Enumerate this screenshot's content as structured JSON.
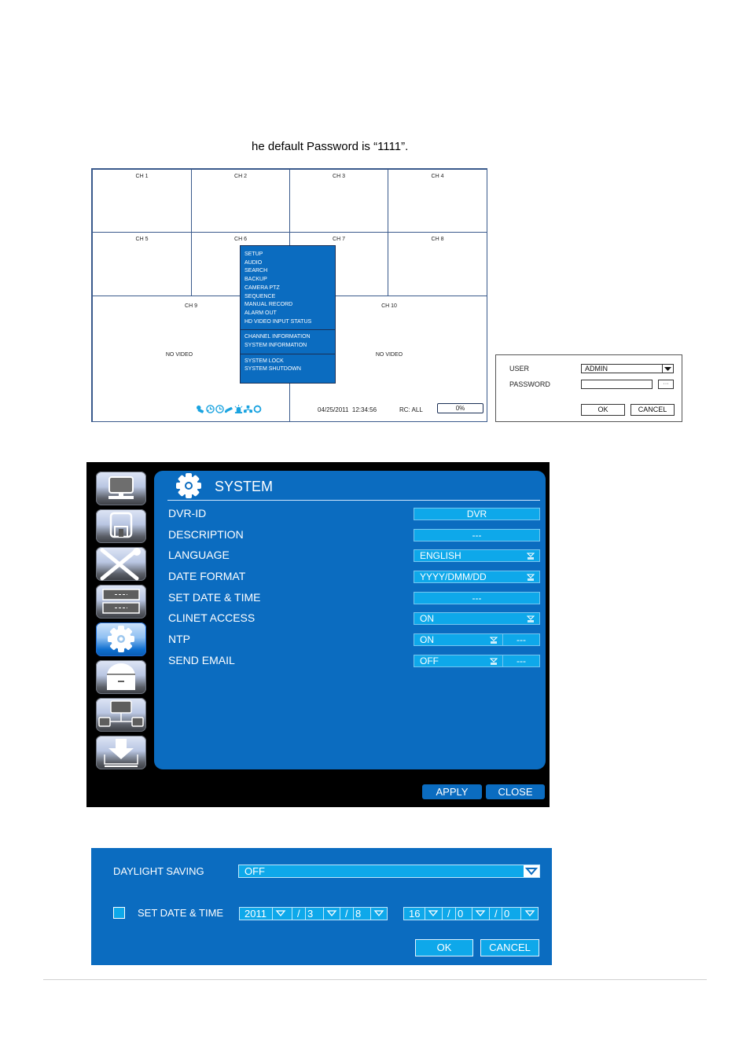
{
  "intro_text": "he default Password is “1111”.",
  "live_view": {
    "channels": [
      "CH 1",
      "CH 2",
      "CH 3",
      "CH 4",
      "CH 5",
      "CH 6",
      "CH 7",
      "CH 8",
      "CH 9",
      "CH 10"
    ],
    "no_video_text": "NO VIDEO",
    "context_menu": {
      "group1": [
        "SETUP",
        "AUDIO",
        "SEARCH",
        "BACKUP",
        "CAMERA PTZ",
        "SEQUENCE",
        "MANUAL RECORD",
        "ALARM OUT",
        "HD VIDEO INPUT STATUS"
      ],
      "group2": [
        "CHANNEL INFORMATION",
        "SYSTEM INFORMATION"
      ],
      "group3": [
        "SYSTEM LOCK",
        "SYSTEM SHUTDOWN"
      ]
    },
    "status_bar": {
      "icons": [
        "key-icon",
        "clock-schedule-icon",
        "clock-icon",
        "camera-icon",
        "alarm-icon",
        "network-icon",
        "refresh-icon"
      ],
      "datetime": "04/25/2011  12:34:56",
      "rc": "RC: ALL",
      "hdd_usage": "0%"
    }
  },
  "login_dialog": {
    "user_label": "USER",
    "user_value": "ADMIN",
    "password_label": "PASSWORD",
    "password_value": "",
    "keyboard_button": "···",
    "ok": "OK",
    "cancel": "CANCEL"
  },
  "system_menu": {
    "sidebar": [
      "display-icon",
      "record-icon",
      "tools-icon",
      "device-icon",
      "system-gear-icon",
      "lock-icon",
      "network-icon",
      "backup-download-icon"
    ],
    "active_index": 4,
    "title": "SYSTEM",
    "rows": [
      {
        "label": "DVR-ID",
        "value": "DVR",
        "type": "text"
      },
      {
        "label": "DESCRIPTION",
        "value": "---",
        "type": "text"
      },
      {
        "label": "LANGUAGE",
        "value": "ENGLISH",
        "type": "dropdown"
      },
      {
        "label": "DATE FORMAT",
        "value": "YYYY/DMM/DD",
        "type": "dropdown"
      },
      {
        "label": "SET DATE & TIME",
        "value": "---",
        "type": "text"
      },
      {
        "label": "CLINET ACCESS",
        "value": "ON",
        "type": "dropdown"
      },
      {
        "label": "NTP",
        "value": "ON",
        "extra": "---",
        "type": "dropdown-split"
      },
      {
        "label": "SEND EMAIL",
        "value": "OFF",
        "extra": "---",
        "type": "dropdown-split"
      }
    ],
    "apply": "APPLY",
    "close": "CLOSE"
  },
  "date_time_dialog": {
    "daylight_label": "DAYLIGHT SAVING",
    "daylight_value": "OFF",
    "set_label": "SET DATE & TIME",
    "set_checked": false,
    "date": {
      "year": "2011",
      "month": "3",
      "day": "8"
    },
    "time": {
      "hour": "16",
      "minute": "0",
      "second": "0"
    },
    "separator": "/",
    "ok": "OK",
    "cancel": "CANCEL"
  },
  "colors": {
    "panel_blue": "#0b6cc0",
    "field_cyan": "#0ea8ea",
    "status_icon": "#1aa3e0"
  }
}
